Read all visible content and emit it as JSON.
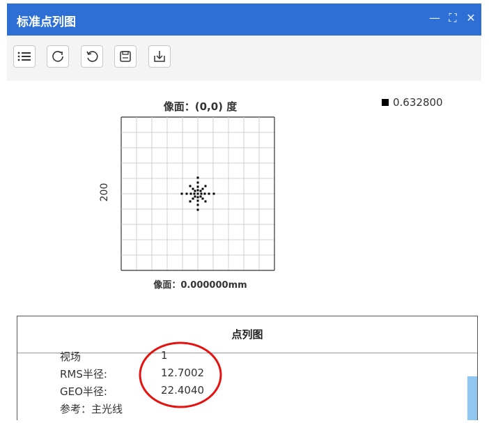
{
  "window": {
    "title": "标准点列图",
    "minimize_glyph": "—",
    "maximize_glyph": "⛶",
    "close_glyph": "✕"
  },
  "toolbar": {
    "buttons": [
      {
        "icon": "list-icon"
      },
      {
        "icon": "refresh-icon"
      },
      {
        "icon": "undo-icon"
      },
      {
        "icon": "save-icon"
      },
      {
        "icon": "download-icon"
      }
    ]
  },
  "plot": {
    "title": "像面：(0,0) 度",
    "legend": "0.632800",
    "ylabel": "200",
    "xlabel": "像面：0.000000mm"
  },
  "panel": {
    "header": "点列图",
    "rows": [
      {
        "label": "视场",
        "value": "1"
      },
      {
        "label": "RMS半径:",
        "value": "12.7002"
      },
      {
        "label": "GEO半径:",
        "value": "22.4040"
      },
      {
        "label": "参考：主光线",
        "value": ""
      }
    ]
  }
}
